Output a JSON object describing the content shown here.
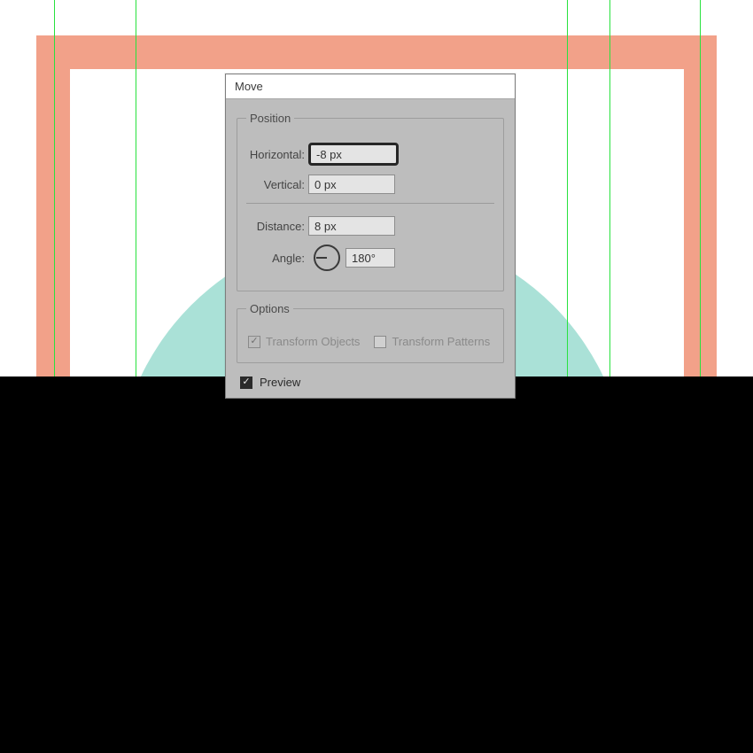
{
  "dialog": {
    "title": "Move",
    "position": {
      "legend": "Position",
      "horizontal_label": "Horizontal:",
      "horizontal_value": "-8 px",
      "vertical_label": "Vertical:",
      "vertical_value": "0 px",
      "distance_label": "Distance:",
      "distance_value": "8 px",
      "angle_label": "Angle:",
      "angle_value": "180°"
    },
    "options": {
      "legend": "Options",
      "transform_objects_label": "Transform Objects",
      "transform_objects_checked": true,
      "transform_patterns_label": "Transform Patterns",
      "transform_patterns_checked": false
    },
    "preview": {
      "label": "Preview",
      "checked": true
    }
  },
  "canvas": {
    "accent_orange": "#f2a189",
    "accent_teal": "#aae1d7",
    "guide_color": "#28e23e"
  }
}
